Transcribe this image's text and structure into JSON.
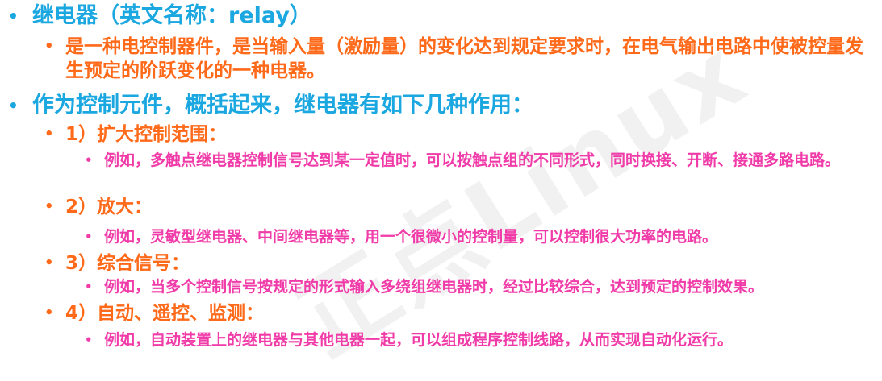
{
  "watermark": "正点Linux",
  "sections": [
    {
      "heading": "继电器（英文名称：relay）",
      "definition": "是一种电控制器件，是当输入量（激励量）的变化达到规定要求时，在电气输出电路中使被控量发生预定的阶跃变化的一种电器。"
    },
    {
      "heading": "作为控制元件，概括起来，继电器有如下几种作用：",
      "functions": [
        {
          "title": "1）扩大控制范围：",
          "example": "例如，多触点继电器控制信号达到某一定值时，可以按触点组的不同形式，同时换接、开断、接通多路电路。"
        },
        {
          "title": "2）放大：",
          "example": "例如，灵敏型继电器、中间继电器等，用一个很微小的控制量，可以控制很大功率的电路。"
        },
        {
          "title": "3）综合信号：",
          "example": "例如，当多个控制信号按规定的形式输入多绕组继电器时，经过比较综合，达到预定的控制效果。"
        },
        {
          "title": "4）自动、遥控、监测：",
          "example": "例如，自动装置上的继电器与其他电器一起，可以组成程序控制线路，从而实现自动化运行。"
        }
      ]
    }
  ],
  "colors": {
    "level1": "#1ba7e0",
    "level2": "#ff6a1a",
    "level3": "#f03ba8"
  },
  "icons": {
    "bullet": "bullet-dot-icon"
  }
}
